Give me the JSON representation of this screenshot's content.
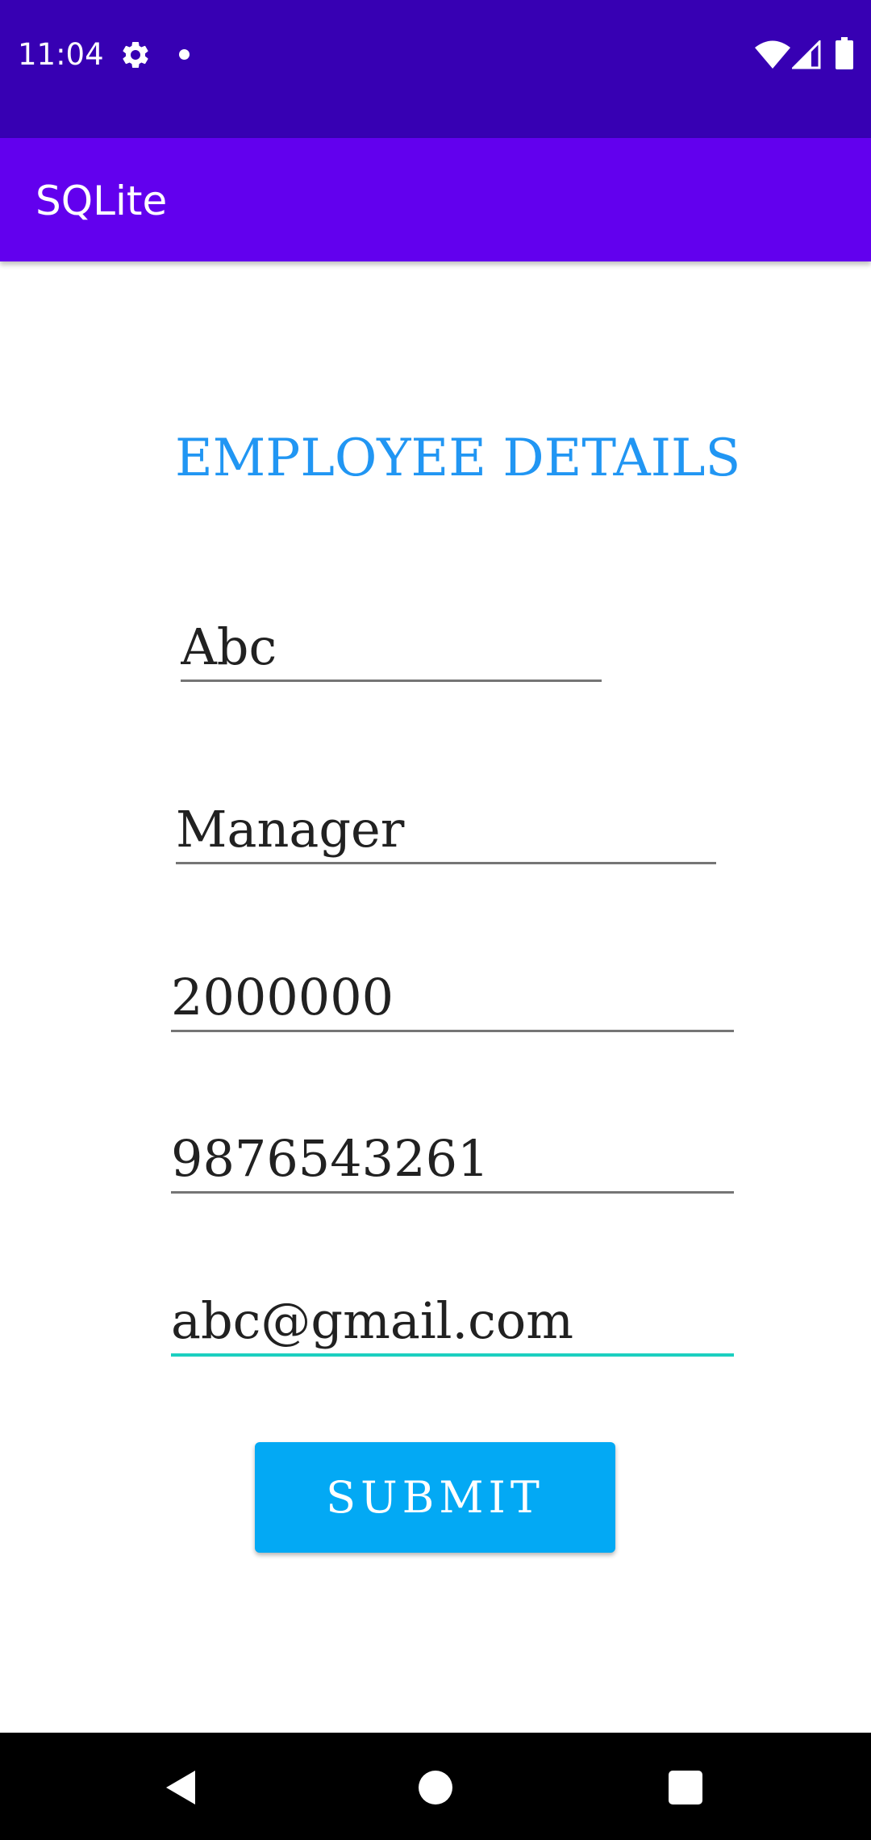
{
  "status_bar": {
    "time": "11:04",
    "icons": [
      "gear-icon",
      "notification-dot-icon",
      "wifi-icon",
      "signal-icon",
      "battery-icon"
    ]
  },
  "app_bar": {
    "title": "SQLite"
  },
  "form": {
    "heading": "EMPLOYEE DETAILS",
    "fields": [
      {
        "value": "Abc"
      },
      {
        "value": "Manager"
      },
      {
        "value": "2000000"
      },
      {
        "value": "9876543261"
      },
      {
        "value": "abc@gmail.com"
      }
    ],
    "submit_label": "SUBMIT"
  },
  "nav_bar": {
    "icons": [
      "back-icon",
      "home-icon",
      "recents-icon"
    ]
  },
  "colors": {
    "status_bar": "#3700b3",
    "app_bar": "#6200ee",
    "heading": "#2196f3",
    "button": "#03a9f4",
    "focused_underline": "#1ccfc0"
  }
}
